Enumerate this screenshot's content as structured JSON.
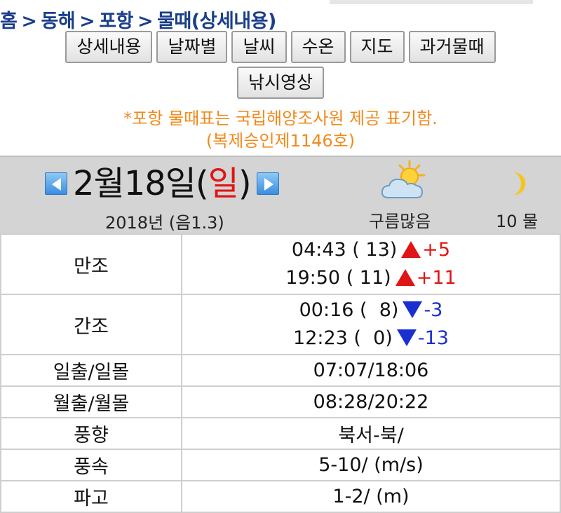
{
  "breadcrumb": {
    "home": "홈",
    "separator": ">",
    "region": "동해",
    "city": "포항",
    "page": "물때(상세내용)"
  },
  "nav_buttons": {
    "detail": "상세내용",
    "by_date": "날짜별",
    "weather": "날씨",
    "water_temp": "수온",
    "map": "지도",
    "past_tide": "과거물때",
    "fishing_video": "낚시영상"
  },
  "notice": {
    "line1": "*포항 물때표는 국립해양조사원 제공 표기함.",
    "line2": "(복제승인제1146호)"
  },
  "day": {
    "date_main": "2월18일(",
    "day_of_week": "일",
    "date_close": ")",
    "year_lunar": "2018년 (음1.3)",
    "weather_label": "구름많음",
    "weather_icon": "partly-cloudy-sun-icon",
    "moon_label": "10 물",
    "moon_icon": "crescent-moon-icon"
  },
  "tide": {
    "high_label": "만조",
    "high": [
      {
        "time_level": "04:43 ( 13)",
        "change": "+5",
        "direction": "up"
      },
      {
        "time_level": "19:50 ( 11)",
        "change": "+11",
        "direction": "up"
      }
    ],
    "low_label": "간조",
    "low": [
      {
        "time_level": "00:16 (  8)",
        "change": "-3",
        "direction": "down"
      },
      {
        "time_level": "12:23 (  0)",
        "change": "-13",
        "direction": "down"
      }
    ]
  },
  "info_rows": [
    {
      "label": "일출/일몰",
      "value": "07:07/18:06"
    },
    {
      "label": "월출/월몰",
      "value": "08:28/20:22"
    },
    {
      "label": "풍향",
      "value": "북서-북/"
    },
    {
      "label": "풍속",
      "value": "5-10/ (m/s)"
    },
    {
      "label": "파고",
      "value": "1-2/ (m)"
    }
  ],
  "colors": {
    "breadcrumb": "#1a3f8a",
    "notice": "#f08a1c",
    "rise": "#e01515",
    "fall": "#1a2fd0",
    "sunday": "#e01515",
    "nav_arrow": "#3a8ee0"
  }
}
